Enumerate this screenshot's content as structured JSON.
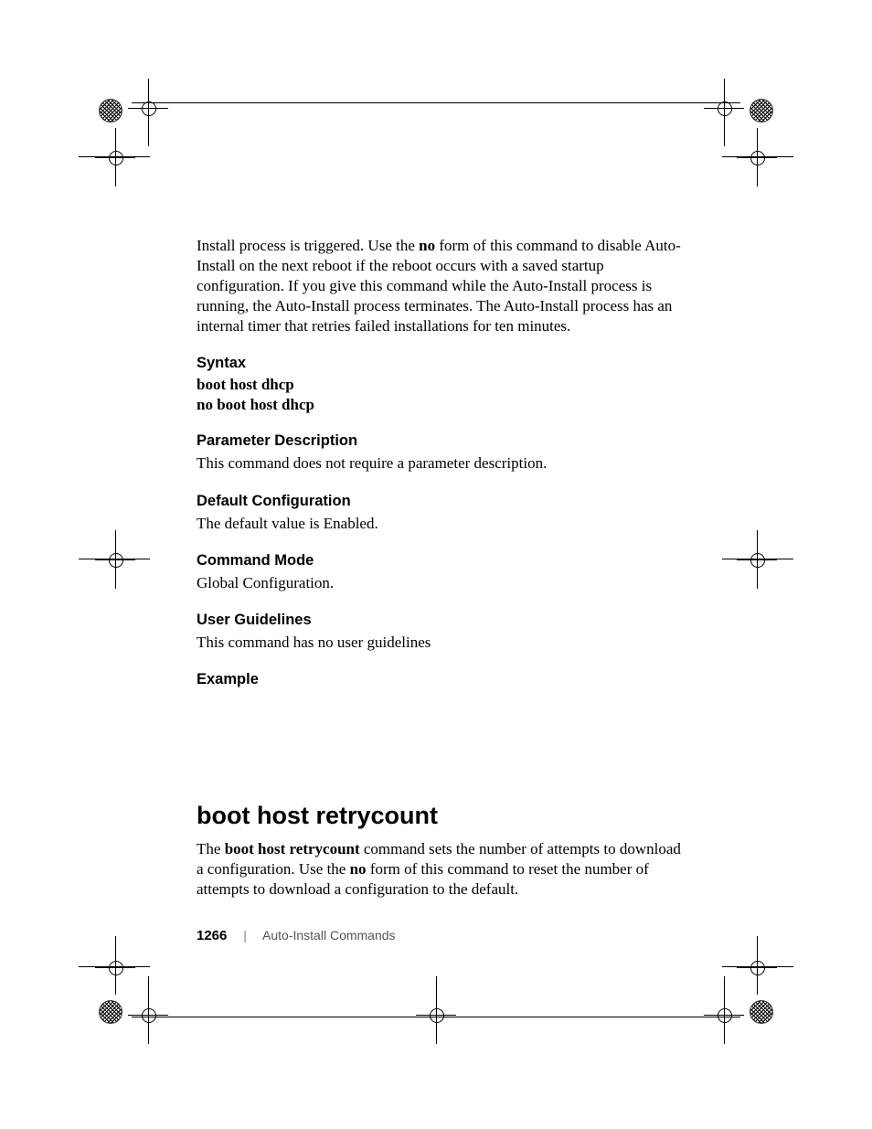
{
  "intro": {
    "part1": "Install process is triggered. Use the ",
    "bold_no1": "no",
    "part2": " form of this command to disable Auto-Install on the next reboot if the reboot occurs with a saved startup configuration. If you give this command while the Auto-Install process is running, the Auto-Install process terminates. The Auto-Install process has an internal timer that retries failed installations for ten minutes."
  },
  "syntax": {
    "heading": "Syntax",
    "line1": "boot host dhcp",
    "line2": "no boot host dhcp"
  },
  "param_desc": {
    "heading": "Parameter Description",
    "body": "This command does not require a parameter description."
  },
  "default_cfg": {
    "heading": "Default Configuration",
    "body": "The default value is Enabled."
  },
  "cmd_mode": {
    "heading": "Command Mode",
    "body": "Global Configuration."
  },
  "user_guidelines": {
    "heading": "User Guidelines",
    "body": "This command has no user guidelines"
  },
  "example": {
    "heading": "Example"
  },
  "next_cmd": {
    "title": "boot host retrycount",
    "body_part1": "The ",
    "body_bold": "boot host retrycount",
    "body_part2": " command sets the number of attempts to download a configuration.  Use the ",
    "body_bold_no": "no",
    "body_part3": " form of this command to reset the number of attempts to download a configuration to the default."
  },
  "footer": {
    "page": "1266",
    "section": "Auto-Install Commands"
  }
}
